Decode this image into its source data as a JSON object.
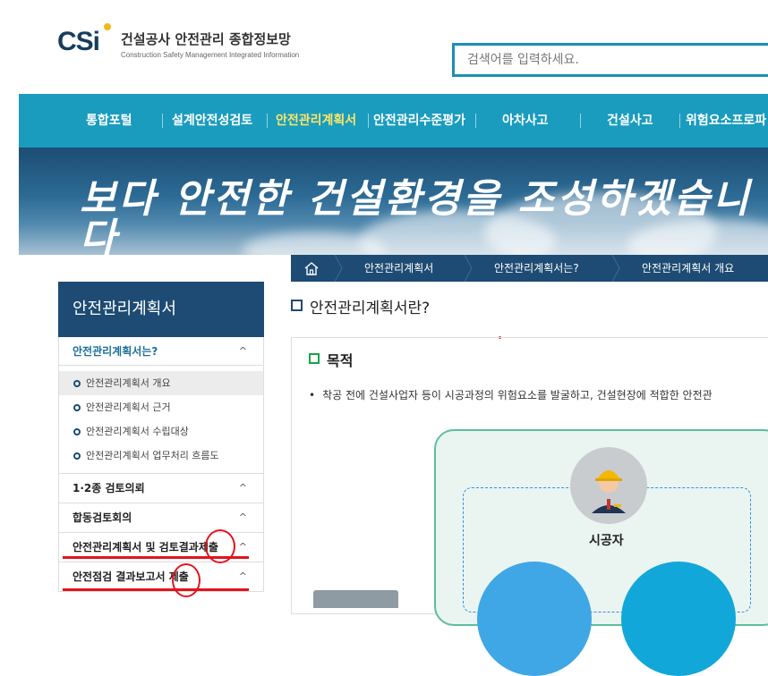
{
  "header": {
    "logo_mark": "CSi",
    "logo_title": "건설공사 안전관리 종합정보망",
    "logo_subtitle": "Construction Safety Management Integrated Information",
    "search_placeholder": "검색어를 입력하세요."
  },
  "gnb": {
    "items": [
      "통합포털",
      "설계안전성검토",
      "안전관리계획서",
      "안전관리수준평가",
      "아차사고",
      "건설사고",
      "위험요소프로파"
    ],
    "active_index": 2,
    "active_color": "#ffe566",
    "bg_color": "#1a9cbf"
  },
  "banner": {
    "text": "보다 안전한 건설환경을 조성하겠습니다"
  },
  "breadcrumb": {
    "home_icon": "home-icon",
    "items": [
      "안전관리계획서",
      "안전관리계획서는?",
      "안전관리계획서 개요"
    ]
  },
  "sidebar": {
    "title": "안전관리계획서",
    "sections": [
      {
        "label": "안전관리계획서는?",
        "expanded": true,
        "items": [
          "안전관리계획서 개요",
          "안전관리계획서 근거",
          "안전관리계획서 수립대상",
          "안전관리계획서 업무처리 흐름도"
        ],
        "selected_index": 0
      },
      {
        "label": "1·2종 검토의뢰"
      },
      {
        "label": "합동검토회의"
      },
      {
        "label": "안전관리계획서 및 검토결과제출"
      },
      {
        "label": "안전점검 결과보고서 제출"
      }
    ],
    "chevron_up": "^"
  },
  "content": {
    "title": "안전관리계획서란?",
    "section_heading": "목적",
    "paragraph": "착공 전에 건설사업자 등이 시공과정의 위험요소를 발굴하고, 건설현장에 적합한 안전관",
    "diagram_person_label": "시공자"
  },
  "colors": {
    "navy": "#1d4b73",
    "teal": "#1a9cbf",
    "annotation_red": "#e3141c"
  }
}
